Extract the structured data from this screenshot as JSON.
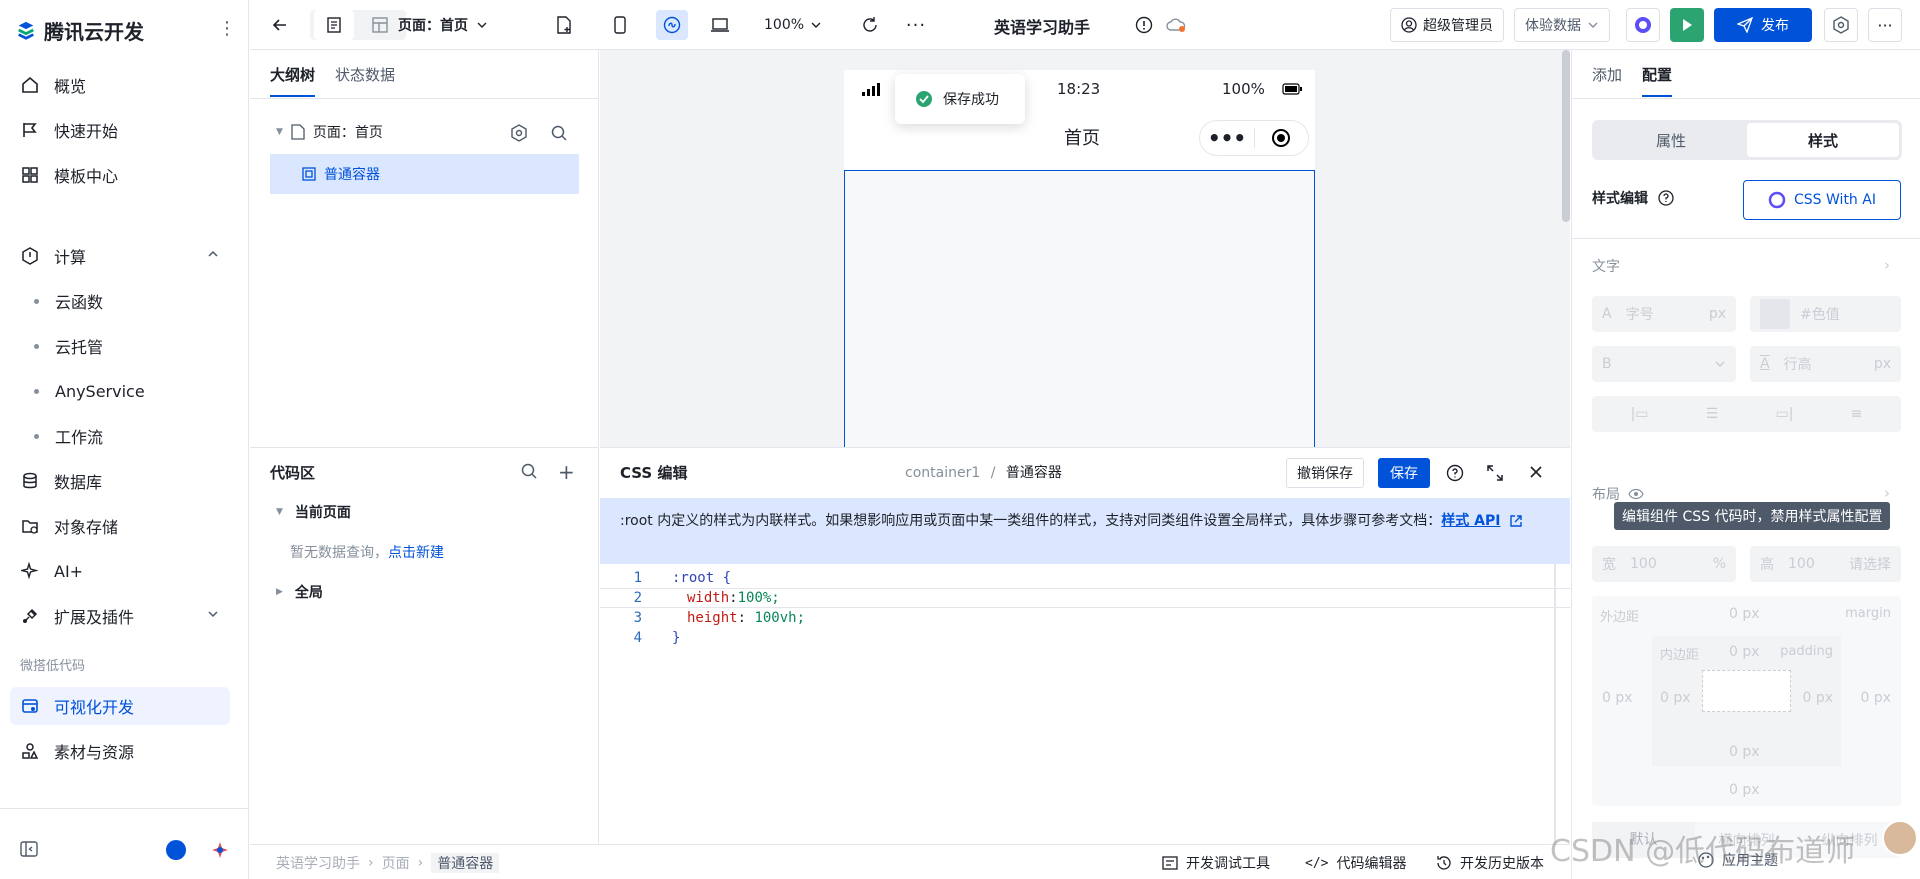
{
  "sidebar": {
    "brand": "腾讯云开发",
    "items": [
      {
        "label": "概览",
        "icon": "home-icon"
      },
      {
        "label": "快速开始",
        "icon": "flag-icon"
      },
      {
        "label": "模板中心",
        "icon": "grid-icon"
      },
      {
        "label": "计算",
        "icon": "compute-icon"
      },
      {
        "label": "云函数"
      },
      {
        "label": "云托管"
      },
      {
        "label": "AnyService"
      },
      {
        "label": "工作流"
      },
      {
        "label": "数据库",
        "icon": "database-icon"
      },
      {
        "label": "对象存储",
        "icon": "storage-icon"
      },
      {
        "label": "AI+",
        "icon": "sparkle-icon"
      },
      {
        "label": "扩展及插件",
        "icon": "plugin-icon"
      },
      {
        "label": "可视化开发",
        "icon": "visual-dev-icon"
      },
      {
        "label": "素材与资源",
        "icon": "assets-icon"
      }
    ],
    "section_label": "微搭低代码"
  },
  "topbar": {
    "page_select": "页面：首页",
    "zoom": "100%",
    "app_title": "英语学习助手",
    "admin": "超级管理员",
    "env": "体验数据",
    "publish": "发布"
  },
  "outline": {
    "tabs": [
      "大纲树",
      "状态数据"
    ],
    "page_node": "页面：首页",
    "container_node": "普通容器"
  },
  "canvas": {
    "time": "18:23",
    "battery": "100%",
    "page_title": "首页",
    "toast": "保存成功"
  },
  "codearea": {
    "title": "代码区",
    "current_page": "当前页面",
    "empty_text": "暂无数据查询，",
    "create_link": "点击新建",
    "global": "全局"
  },
  "csseditor": {
    "title": "CSS 编辑",
    "breadcrumb_1": "container1",
    "breadcrumb_sep": "/",
    "breadcrumb_2": "普通容器",
    "undo_save": "撤销保存",
    "save": "保存",
    "notice": ":root 内定义的样式为内联样式。如果想影响应用或页面中某一类组件的样式，支持对同类组件设置全局样式，具体步骤可参考文档：",
    "notice_link": "样式 API",
    "lines": [
      {
        "n": "1",
        "text": ":root {"
      },
      {
        "n": "2",
        "prop": "width",
        "val": "100%;"
      },
      {
        "n": "3",
        "prop": "height",
        "val": " 100vh;"
      },
      {
        "n": "4",
        "text": "}"
      }
    ]
  },
  "statusbar": {
    "crumbs": [
      "英语学习助手",
      "页面",
      "普通容器"
    ],
    "debug_tools": "开发调试工具",
    "code_editor": "代码编辑器",
    "history": "开发历史版本",
    "theme": "应用主题"
  },
  "rightpanel": {
    "tabs": [
      "添加",
      "配置"
    ],
    "seg": [
      "属性",
      "样式"
    ],
    "style_edit": "样式编辑",
    "css_ai": "CSS With AI",
    "text_section": "文字",
    "font_size_ph": "字号",
    "font_unit": "px",
    "color_ph": "#色值",
    "line_height_ph": "行高",
    "layout_section": "布局",
    "tooltip": "编辑组件 CSS 代码时，禁用样式属性配置",
    "width_label": "宽",
    "width_val": "100",
    "width_unit": "%",
    "height_label": "高",
    "height_val": "100",
    "height_ph": "请选择",
    "margin_label": "外边距",
    "margin_en": "margin",
    "padding_label": "内边距",
    "padding_en": "padding",
    "zero_px": "0 px",
    "layout_opts": [
      "默认",
      "横向排列",
      "纵向排列"
    ]
  },
  "watermark": "CSDN @低代码布道师"
}
